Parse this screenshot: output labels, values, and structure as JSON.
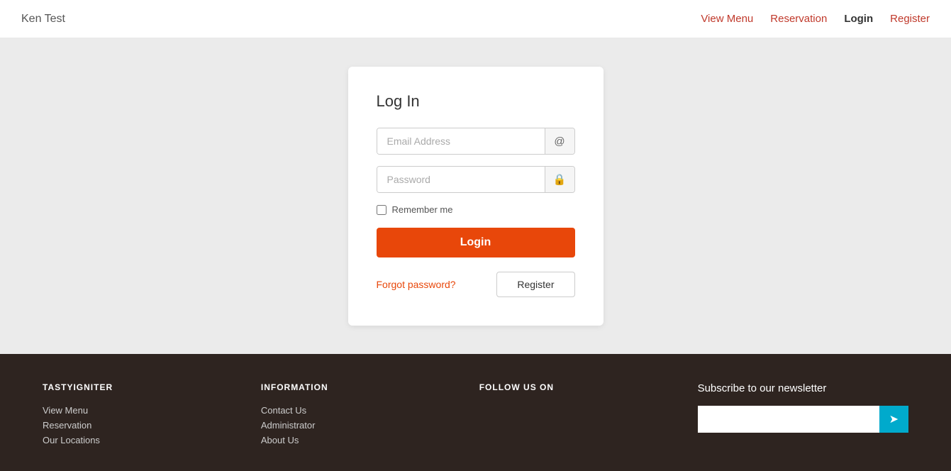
{
  "navbar": {
    "brand": "Ken Test",
    "links": [
      {
        "label": "View Menu",
        "href": "#",
        "active": false
      },
      {
        "label": "Reservation",
        "href": "#",
        "active": false
      },
      {
        "label": "Login",
        "href": "#",
        "active": true
      },
      {
        "label": "Register",
        "href": "#",
        "active": false
      }
    ]
  },
  "login_card": {
    "title": "Log In",
    "email_placeholder": "Email Address",
    "password_placeholder": "Password",
    "remember_label": "Remember me",
    "login_button": "Login",
    "forgot_password": "Forgot password?",
    "register_button": "Register",
    "email_icon": "@",
    "password_icon": "🔒"
  },
  "footer": {
    "col1": {
      "title": "TASTYIGNITER",
      "links": [
        "View Menu",
        "Reservation",
        "Our Locations"
      ]
    },
    "col2": {
      "title": "INFORMATION",
      "links": [
        "Contact Us",
        "Administrator",
        "About Us"
      ]
    },
    "col3": {
      "title": "FOLLOW US ON",
      "links": []
    },
    "newsletter": {
      "title": "Subscribe to our newsletter",
      "placeholder": "",
      "button_icon": "➤"
    }
  }
}
